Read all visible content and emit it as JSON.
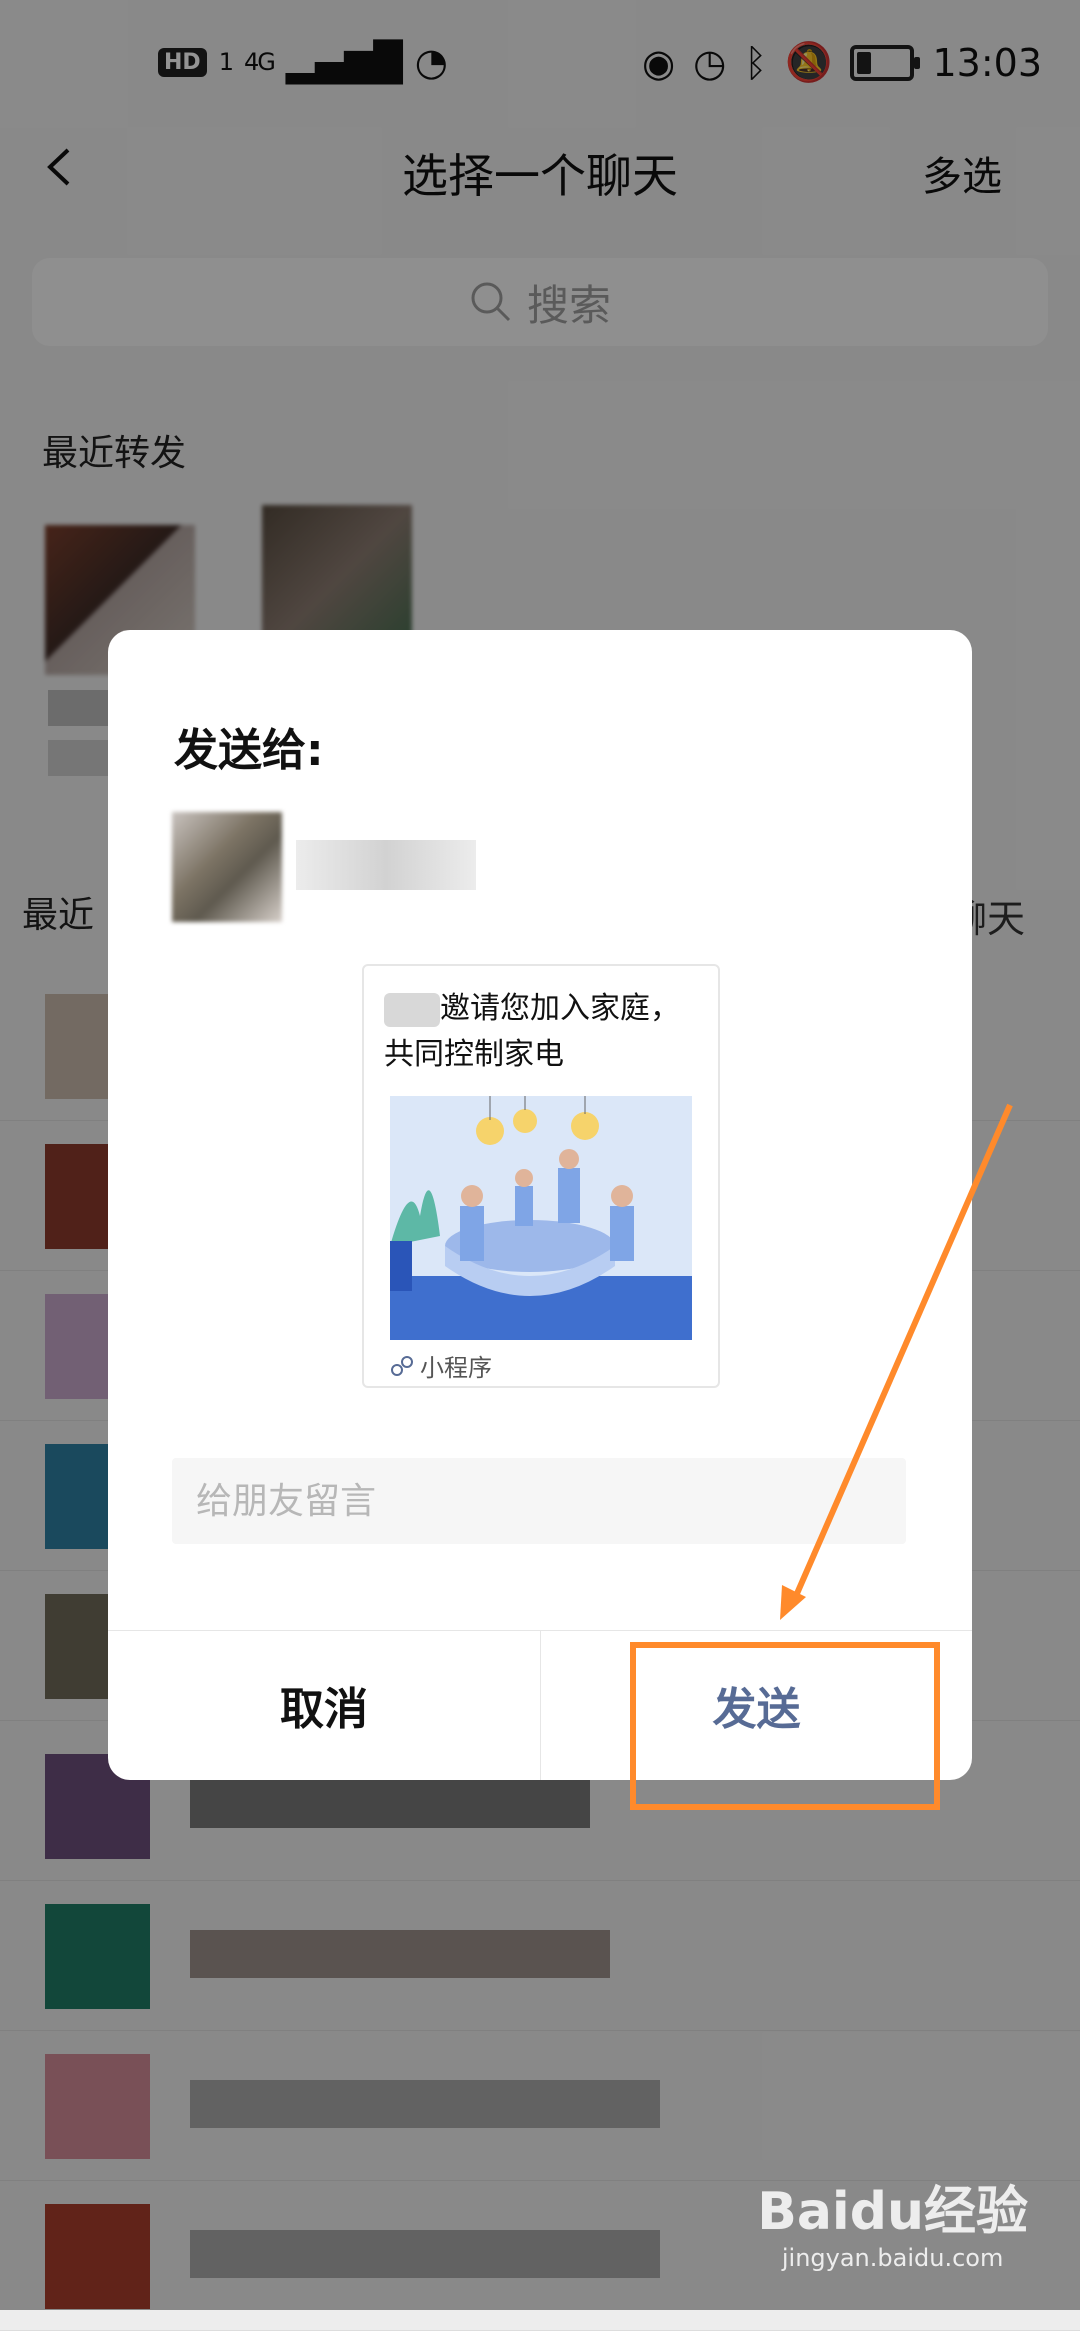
{
  "status_bar": {
    "hd_badge": "HD",
    "sim": "1",
    "network": "4G",
    "time": "13:03",
    "icons": [
      "eye-icon",
      "alarm-icon",
      "bluetooth-icon",
      "mute-bell-icon",
      "battery-icon"
    ]
  },
  "nav": {
    "back_icon": "chevron-left-icon",
    "title": "选择一个聊天",
    "right_action": "多选"
  },
  "search": {
    "placeholder": "搜索",
    "icon": "search-icon"
  },
  "recent_section": {
    "label": "最近转发",
    "partial_label": "最近",
    "partial_right": "聊天"
  },
  "dialog": {
    "title": "发送给:",
    "card": {
      "title": "邀请您加入家庭，共同控制家电",
      "footer_label": "小程序",
      "footer_icon": "mini-program-icon"
    },
    "message_placeholder": "给朋友留言",
    "cancel_label": "取消",
    "send_label": "发送"
  },
  "watermark": {
    "logo": "Baidu经验",
    "domain": "jingyan.baidu.com"
  },
  "colors": {
    "accent": "#576b95",
    "annotation": "#ff8a2b",
    "overlay": "rgba(0,0,0,0.42)"
  }
}
